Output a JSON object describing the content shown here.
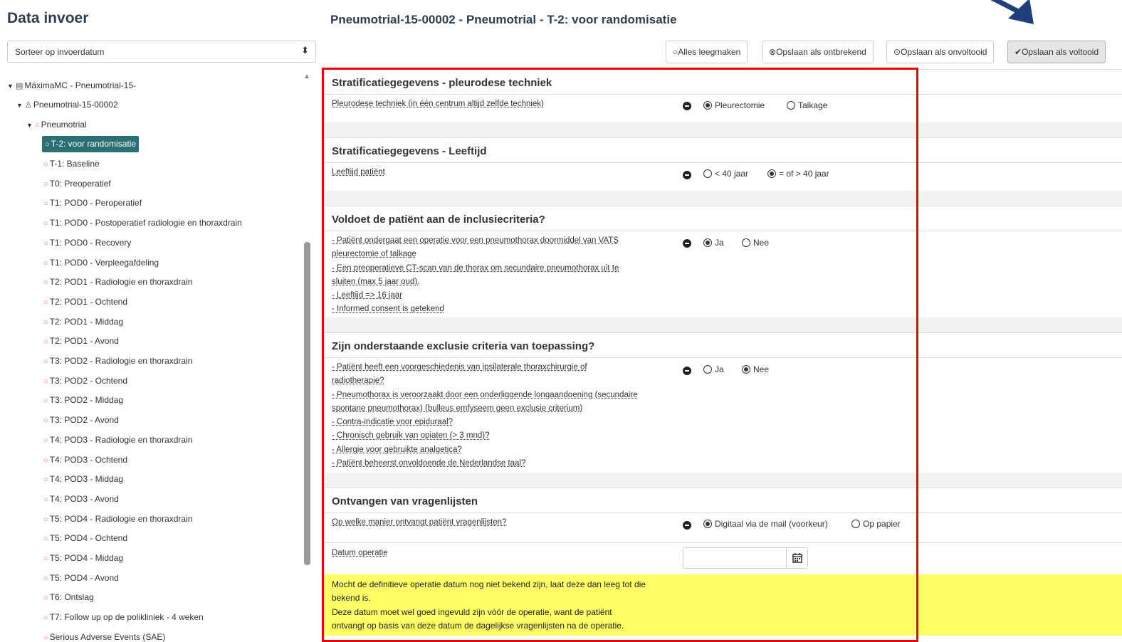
{
  "left": {
    "title": "Data invoer",
    "sort_value": "Sorteer op invoerdatum"
  },
  "tree": {
    "root": "MáximaMC - Pneumotrial-15-",
    "patient": "Pneumotrial-15-00002",
    "study": "Pneumotrial",
    "selected": "T-2: voor randomisatie",
    "items": [
      "T-1: Baseline",
      "T0: Preoperatief",
      "T1: POD0 - Peroperatief",
      "T1: POD0 - Postoperatief radiologie en thoraxdrain",
      "T1: POD0 - Recovery",
      "T1: POD0 - Verpleegafdeling",
      "T2: POD1 - Radiologie en thoraxdrain",
      "T2: POD1 - Ochtend",
      "T2: POD1 - Middag",
      "T2: POD1 - Avond",
      "T3: POD2 - Radiologie en thoraxdrain",
      "T3: POD2 - Ochtend",
      "T3: POD2 - Middag",
      "T3: POD2 - Avond",
      "T4: POD3 - Radiologie en thoraxdrain",
      "T4: POD3 - Ochtend",
      "T4: POD3 - Middag",
      "T4: POD3 - Avond",
      "T5: POD4 - Radiologie en thoraxdrain",
      "T5: POD4 - Ochtend",
      "T5: POD4 - Middag",
      "T5: POD4 - Avond",
      "T6: Ontslag",
      "T7: Follow up op de polikliniek - 4 weken",
      "Serious Adverse Events (SAE)"
    ]
  },
  "form": {
    "title": "Pneumotrial-15-00002 - Pneumotrial - T-2: voor randomisatie",
    "buttons": {
      "clear": "Alles leegmaken",
      "save_missing": "Opslaan als ontbrekend",
      "save_incomplete": "Opslaan als onvoltooid",
      "save_complete": "Opslaan als voltooid"
    },
    "sections": {
      "s1": {
        "title": "Stratificatiegegevens - pleurodese techniek",
        "question": "Pleurodese techniek (in één centrum altijd zelfde techniek)",
        "options": [
          "Pleurectomie",
          "Talkage"
        ],
        "selected": "Pleurectomie"
      },
      "s2": {
        "title": "Stratificatiegegevens - Leeftijd",
        "question": "Leeftijd patiënt",
        "options": [
          "< 40 jaar",
          "= of > 40 jaar"
        ],
        "selected": "= of > 40 jaar"
      },
      "s3": {
        "title": "Voldoet de patiënt aan de inclusiecriteria?",
        "lines": [
          "- Patiënt ondergaat een operatie voor een pneumothorax doormiddel van VATS",
          "pleurectomie of talkage",
          "- Een preoperatieve CT-scan van de thorax om secundaire pneumothorax uit te",
          "sluiten (max 5 jaar oud).",
          "- Leeftijd => 16 jaar",
          "- Informed consent is getekend"
        ],
        "options": [
          "Ja",
          "Nee"
        ],
        "selected": "Ja"
      },
      "s4": {
        "title": "Zijn onderstaande exclusie criteria van toepassing?",
        "lines": [
          "- Patiënt heeft een voorgeschiedenis van ipsilaterale thoraxchirurgie of",
          "radiotherapie?",
          "- Pneumothorax is veroorzaakt door een onderliggende longaandoening (secundaire",
          "spontane pneumothorax) (bulleus emfyseem geen exclusie criterium)",
          "- Contra-indicatie voor epiduraal?",
          "- Chronisch gebruik van opiaten (> 3 mnd)?",
          "- Allergie voor gebruikte analgetica?",
          "- Patiënt beheerst onvoldoende de Nederlandse taal?"
        ],
        "options": [
          "Ja",
          "Nee"
        ],
        "selected": "Nee"
      },
      "s5": {
        "title": "Ontvangen van vragenlijsten",
        "question": "Op welke manier ontvangt patiënt vragenlijsten?",
        "options": [
          "Digitaal via de mail (voorkeur)",
          "Op papier"
        ],
        "selected": "Digitaal via de mail (voorkeur)",
        "date_label": "Datum operatie",
        "date_value": "",
        "note": [
          "Mocht de definitieve operatie datum nog niet bekend zijn, laat deze dan leeg tot die",
          "bekend is.",
          "Deze datum moet wel goed ingevuld zijn vóór de operatie, want de patiënt",
          "ontvangt op basis van deze datum de dagelijkse vragenlijsten na de operatie."
        ]
      }
    }
  },
  "colors": {
    "selected_bg": "#2a6f73",
    "highlight_box": "#ee0000",
    "note_bg": "#ffff66",
    "arrow": "#1f3f7a",
    "status_icon": "#e8678a"
  }
}
